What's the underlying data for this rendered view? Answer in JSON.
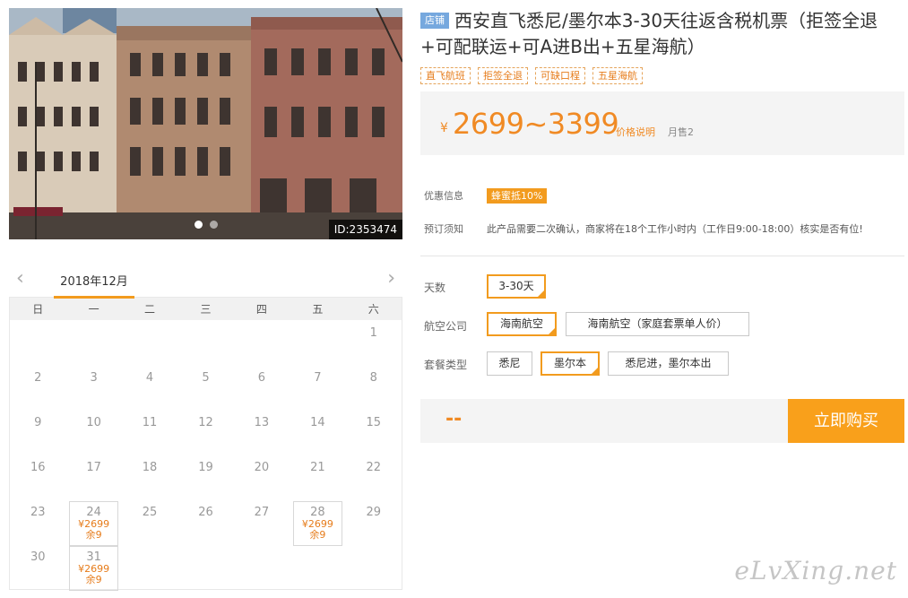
{
  "photo": {
    "id_label": "ID:2353474",
    "dots": 2
  },
  "calendar": {
    "month": "2018年12月",
    "prev_icon": "chevron-left-icon",
    "next_icon": "chevron-right-icon",
    "weekdays": [
      "日",
      "一",
      "二",
      "三",
      "四",
      "五",
      "六"
    ],
    "days": [
      {
        "d": "",
        "price": "",
        "stock": ""
      },
      {
        "d": "",
        "price": "",
        "stock": ""
      },
      {
        "d": "",
        "price": "",
        "stock": ""
      },
      {
        "d": "",
        "price": "",
        "stock": ""
      },
      {
        "d": "",
        "price": "",
        "stock": ""
      },
      {
        "d": "",
        "price": "",
        "stock": ""
      },
      {
        "d": "1",
        "price": "",
        "stock": ""
      },
      {
        "d": "2",
        "price": "",
        "stock": ""
      },
      {
        "d": "3",
        "price": "",
        "stock": ""
      },
      {
        "d": "4",
        "price": "",
        "stock": ""
      },
      {
        "d": "5",
        "price": "",
        "stock": ""
      },
      {
        "d": "6",
        "price": "",
        "stock": ""
      },
      {
        "d": "7",
        "price": "",
        "stock": ""
      },
      {
        "d": "8",
        "price": "",
        "stock": ""
      },
      {
        "d": "9",
        "price": "",
        "stock": ""
      },
      {
        "d": "10",
        "price": "",
        "stock": ""
      },
      {
        "d": "11",
        "price": "",
        "stock": ""
      },
      {
        "d": "12",
        "price": "",
        "stock": ""
      },
      {
        "d": "13",
        "price": "",
        "stock": ""
      },
      {
        "d": "14",
        "price": "",
        "stock": ""
      },
      {
        "d": "15",
        "price": "",
        "stock": ""
      },
      {
        "d": "16",
        "price": "",
        "stock": ""
      },
      {
        "d": "17",
        "price": "",
        "stock": ""
      },
      {
        "d": "18",
        "price": "",
        "stock": ""
      },
      {
        "d": "19",
        "price": "",
        "stock": ""
      },
      {
        "d": "20",
        "price": "",
        "stock": ""
      },
      {
        "d": "21",
        "price": "",
        "stock": ""
      },
      {
        "d": "22",
        "price": "",
        "stock": ""
      },
      {
        "d": "23",
        "price": "",
        "stock": ""
      },
      {
        "d": "24",
        "price": "¥2699",
        "stock": "余9"
      },
      {
        "d": "25",
        "price": "",
        "stock": ""
      },
      {
        "d": "26",
        "price": "",
        "stock": ""
      },
      {
        "d": "27",
        "price": "",
        "stock": ""
      },
      {
        "d": "28",
        "price": "¥2699",
        "stock": "余9"
      },
      {
        "d": "29",
        "price": "",
        "stock": ""
      },
      {
        "d": "30",
        "price": "",
        "stock": ""
      },
      {
        "d": "31",
        "price": "¥2699",
        "stock": "余9"
      }
    ]
  },
  "product": {
    "shop_tag": "店铺",
    "title": "西安直飞悉尼/墨尔本3-30天往返含税机票（拒签全退+可配联运+可A进B出+五星海航）",
    "tags": [
      "直飞航班",
      "拒签全退",
      "可缺口程",
      "五星海航"
    ],
    "price_currency": "¥",
    "price_range": "2699~3399",
    "price_explain": "价格说明",
    "monthly_sales": "月售2",
    "promo_label": "优惠信息",
    "promo_badge": "蜂蜜抵10%",
    "notice_label": "预订须知",
    "notice_text": "此产品需要二次确认，商家将在18个工作小时内（工作日9:00-18:00）核实是否有位!"
  },
  "options": {
    "days_label": "天数",
    "days_values": [
      "3-30天"
    ],
    "airline_label": "航空公司",
    "airline_values": [
      "海南航空",
      "海南航空（家庭套票单人价）"
    ],
    "package_label": "套餐类型",
    "package_values": [
      "悉尼",
      "墨尔本",
      "悉尼进，墨尔本出"
    ]
  },
  "buy": {
    "total_placeholder": "--",
    "button_label": "立即购买"
  },
  "watermark": "eLvXing.net",
  "colors": {
    "accent": "#f29b1e",
    "price": "#f08a24",
    "shop_tag": "#76a8de"
  }
}
